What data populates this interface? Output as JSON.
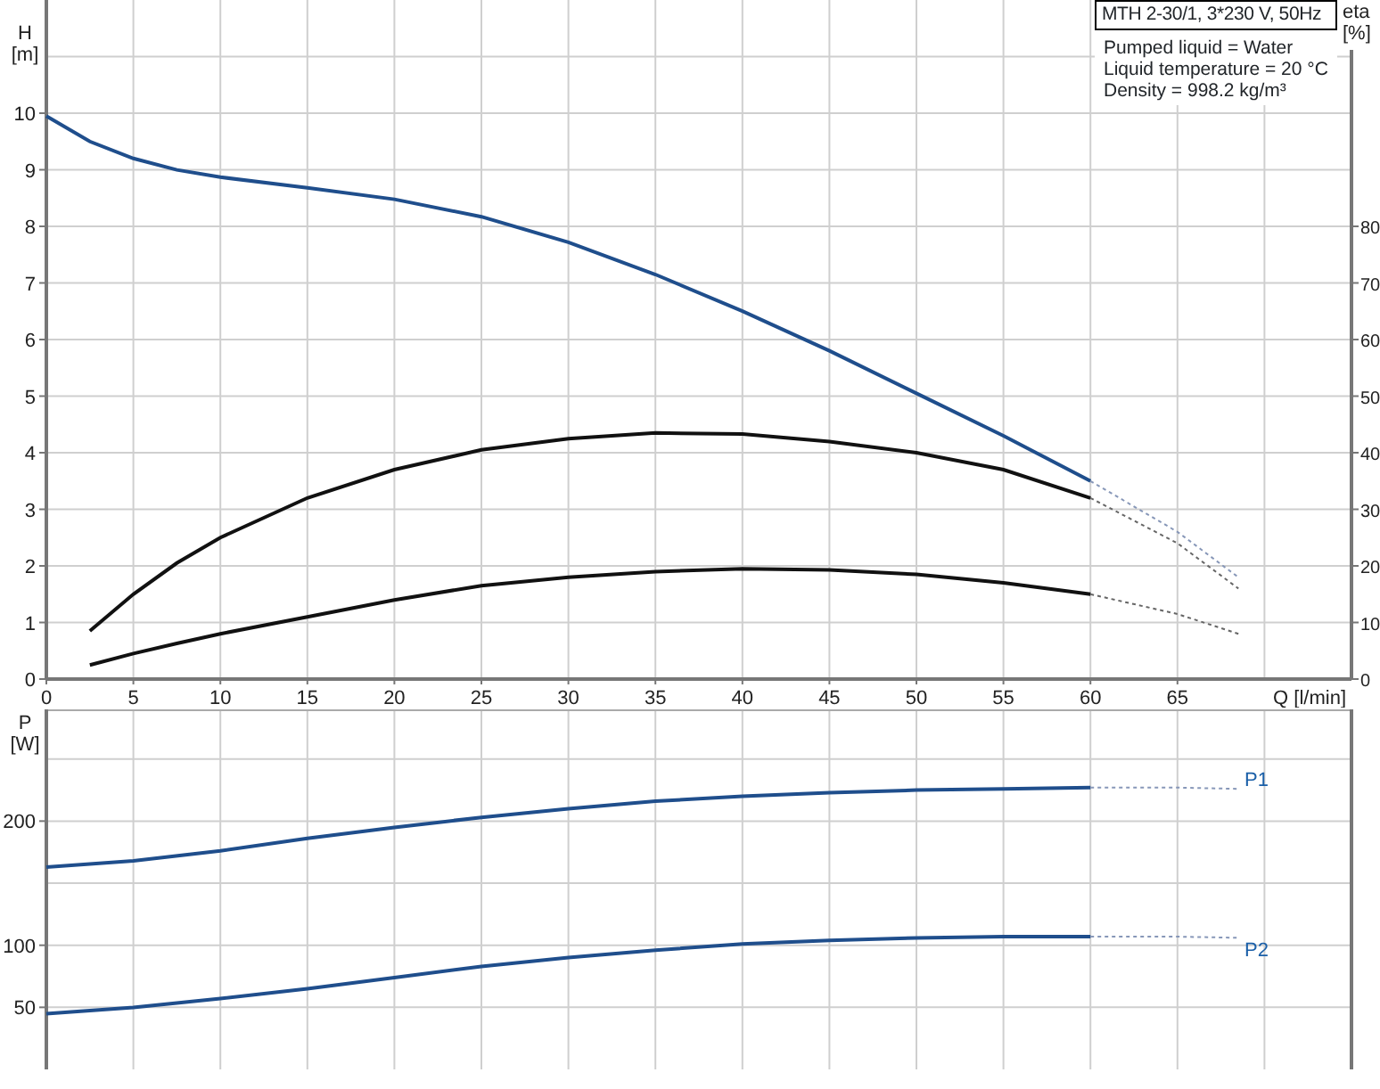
{
  "info_box": {
    "title": "MTH 2-30/1, 3*230 V, 50Hz",
    "lines": [
      "Pumped liquid = Water",
      "Liquid temperature = 20 °C",
      "Density = 998.2 kg/m³"
    ]
  },
  "head_chart": {
    "chart_data": {
      "type": "line",
      "xlabel": "Q [l/min]",
      "ylabel": "H [m]",
      "y2label": "eta [%]",
      "xlim": [
        0,
        75
      ],
      "ylim": [
        0,
        12
      ],
      "y2lim": [
        0,
        120
      ],
      "xticks": [
        0,
        5,
        10,
        15,
        20,
        25,
        30,
        35,
        40,
        45,
        50,
        55,
        60,
        65
      ],
      "yticks": [
        0,
        1,
        2,
        3,
        4,
        5,
        6,
        7,
        8,
        9,
        10
      ],
      "y2ticks": [
        0,
        10,
        20,
        30,
        40,
        50,
        60,
        70,
        80
      ],
      "grid": true,
      "x": [
        0,
        2.5,
        5,
        7.5,
        10,
        15,
        20,
        25,
        30,
        35,
        40,
        45,
        50,
        55,
        60,
        65,
        68.5
      ],
      "series": [
        {
          "color": "#1f4e8c",
          "axis": "y",
          "values": [
            9.95,
            9.5,
            9.2,
            9.0,
            8.87,
            8.68,
            8.48,
            8.17,
            7.72,
            7.15,
            6.5,
            5.8,
            5.05,
            4.3,
            3.5,
            null,
            null
          ]
        },
        {
          "color": "#111111",
          "axis": "y2",
          "values": [
            null,
            8.5,
            15,
            20.5,
            25,
            32,
            37,
            40.5,
            42.5,
            43.5,
            43.3,
            42,
            40,
            37,
            32,
            null,
            null
          ]
        },
        {
          "color": "#111111",
          "axis": "y",
          "values": [
            null,
            0.25,
            0.45,
            0.63,
            0.8,
            1.1,
            1.4,
            1.65,
            1.8,
            1.9,
            1.95,
            1.93,
            1.85,
            1.7,
            1.5,
            null,
            null
          ]
        },
        {
          "color": "#8797b8",
          "axis": "y",
          "line_style": "dashed",
          "values": [
            null,
            null,
            null,
            null,
            null,
            null,
            null,
            null,
            null,
            null,
            null,
            null,
            null,
            null,
            3.5,
            2.6,
            1.8
          ]
        },
        {
          "color": "#666666",
          "axis": "y2",
          "line_style": "dashed",
          "values": [
            null,
            null,
            null,
            null,
            null,
            null,
            null,
            null,
            null,
            null,
            null,
            null,
            null,
            null,
            32,
            24,
            16
          ]
        },
        {
          "color": "#666666",
          "axis": "y",
          "line_style": "dashed",
          "values": [
            null,
            null,
            null,
            null,
            null,
            null,
            null,
            null,
            null,
            null,
            null,
            null,
            null,
            null,
            1.5,
            1.15,
            0.8
          ]
        }
      ]
    }
  },
  "power_chart": {
    "chart_data": {
      "type": "line",
      "ylabel": "P [W]",
      "xlim": [
        0,
        75
      ],
      "ylim": [
        0,
        290
      ],
      "yticks": [
        50,
        100,
        200
      ],
      "grid": true,
      "x": [
        0,
        5,
        10,
        15,
        20,
        25,
        30,
        35,
        40,
        45,
        50,
        55,
        60,
        65,
        68.5
      ],
      "series": [
        {
          "name": "P1",
          "color": "#1f4e8c",
          "values": [
            163,
            168,
            176,
            186,
            195,
            203,
            210,
            216,
            220,
            223,
            225,
            226,
            227,
            null,
            null
          ]
        },
        {
          "name": "P2",
          "color": "#1f4e8c",
          "values": [
            45,
            50,
            57,
            65,
            74,
            83,
            90,
            96,
            101,
            104,
            106,
            107,
            107,
            null,
            null
          ]
        },
        {
          "color": "#8797b8",
          "line_style": "dashed",
          "values": [
            null,
            null,
            null,
            null,
            null,
            null,
            null,
            null,
            null,
            null,
            null,
            null,
            227,
            227,
            226
          ]
        },
        {
          "color": "#8797b8",
          "line_style": "dashed",
          "values": [
            null,
            null,
            null,
            null,
            null,
            null,
            null,
            null,
            null,
            null,
            null,
            null,
            107,
            107,
            106
          ]
        }
      ]
    }
  }
}
